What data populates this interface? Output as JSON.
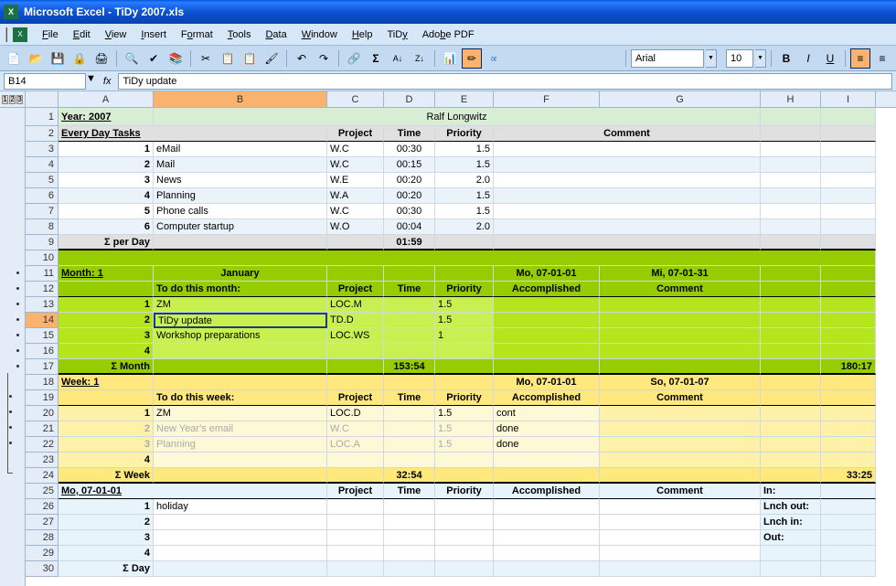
{
  "title": "Microsoft Excel - TiDy 2007.xls",
  "menus": [
    "File",
    "Edit",
    "View",
    "Insert",
    "Format",
    "Tools",
    "Data",
    "Window",
    "Help",
    "TiDy",
    "Adobe PDF"
  ],
  "font_name": "Arial",
  "font_size": "10",
  "name_box": "B14",
  "formula": "TiDy update",
  "columns": [
    "A",
    "B",
    "C",
    "D",
    "E",
    "F",
    "G",
    "H",
    "I"
  ],
  "year_label": "Year:  2007",
  "author": "Ralf Longwitz",
  "headers_day": {
    "a": "Every Day Tasks",
    "proj": "Project",
    "time": "Time",
    "prio": "Priority",
    "comment": "Comment"
  },
  "day_tasks": [
    {
      "n": "1",
      "name": "eMail",
      "proj": "W.C",
      "time": "00:30",
      "prio": "1.5"
    },
    {
      "n": "2",
      "name": "Mail",
      "proj": "W.C",
      "time": "00:15",
      "prio": "1.5"
    },
    {
      "n": "3",
      "name": "News",
      "proj": "W.E",
      "time": "00:20",
      "prio": "2.0"
    },
    {
      "n": "4",
      "name": "Planning",
      "proj": "W.A",
      "time": "00:20",
      "prio": "1.5"
    },
    {
      "n": "5",
      "name": "Phone calls",
      "proj": "W.C",
      "time": "00:30",
      "prio": "1.5"
    },
    {
      "n": "6",
      "name": "Computer startup",
      "proj": "W.O",
      "time": "00:04",
      "prio": "2.0"
    }
  ],
  "sigma_day_label": "Σ per Day",
  "sigma_day_time": "01:59",
  "month_label": "Month:  1",
  "month_name": "January",
  "month_start": "Mo, 07-01-01",
  "month_end": "Mi, 07-01-31",
  "month_headers": {
    "todo": "To do this month:",
    "proj": "Project",
    "time": "Time",
    "prio": "Priority",
    "acc": "Accomplished",
    "comment": "Comment"
  },
  "month_tasks": [
    {
      "n": "1",
      "name": "ZM",
      "proj": "LOC.M",
      "time": "",
      "prio": "1.5"
    },
    {
      "n": "2",
      "name": "TiDy update",
      "proj": "TD.D",
      "time": "",
      "prio": "1.5"
    },
    {
      "n": "3",
      "name": "Workshop preparations",
      "proj": "LOC.WS",
      "time": "",
      "prio": "1"
    },
    {
      "n": "4",
      "name": "",
      "proj": "",
      "time": "",
      "prio": ""
    }
  ],
  "sigma_month_label": "Σ Month",
  "sigma_month_time": "153:54",
  "sigma_month_i": "180:17",
  "week_label": "Week: 1",
  "week_start": "Mo, 07-01-01",
  "week_end": "So, 07-01-07",
  "week_headers": {
    "todo": "To do this week:",
    "proj": "Project",
    "time": "Time",
    "prio": "Priority",
    "acc": "Accomplished",
    "comment": "Comment"
  },
  "week_tasks": [
    {
      "n": "1",
      "name": "ZM",
      "proj": "LOC.D",
      "time": "",
      "prio": "1.5",
      "acc": "cont",
      "faded": false
    },
    {
      "n": "2",
      "name": "New Year's email",
      "proj": "W.C",
      "time": "",
      "prio": "1.5",
      "acc": "done",
      "faded": true
    },
    {
      "n": "3",
      "name": "Planning",
      "proj": "LOC.A",
      "time": "",
      "prio": "1.5",
      "acc": "done",
      "faded": true
    },
    {
      "n": "4",
      "name": "",
      "proj": "",
      "time": "",
      "prio": "",
      "acc": "",
      "faded": false
    }
  ],
  "sigma_week_label": "Σ Week",
  "sigma_week_time": "32:54",
  "sigma_week_i": "33:25",
  "day_date": "Mo, 07-01-01",
  "day_headers": {
    "proj": "Project",
    "time": "Time",
    "prio": "Priority",
    "acc": "Accomplished",
    "comment": "Comment"
  },
  "day_h": {
    "in": "In:",
    "lnch_out": "Lnch out:",
    "lnch_in": "Lnch in:",
    "out": "Out:"
  },
  "day_items": [
    {
      "n": "1",
      "name": "holiday"
    },
    {
      "n": "2",
      "name": ""
    },
    {
      "n": "3",
      "name": ""
    },
    {
      "n": "4",
      "name": ""
    }
  ],
  "sigma_dayrow_label": "Σ Day"
}
